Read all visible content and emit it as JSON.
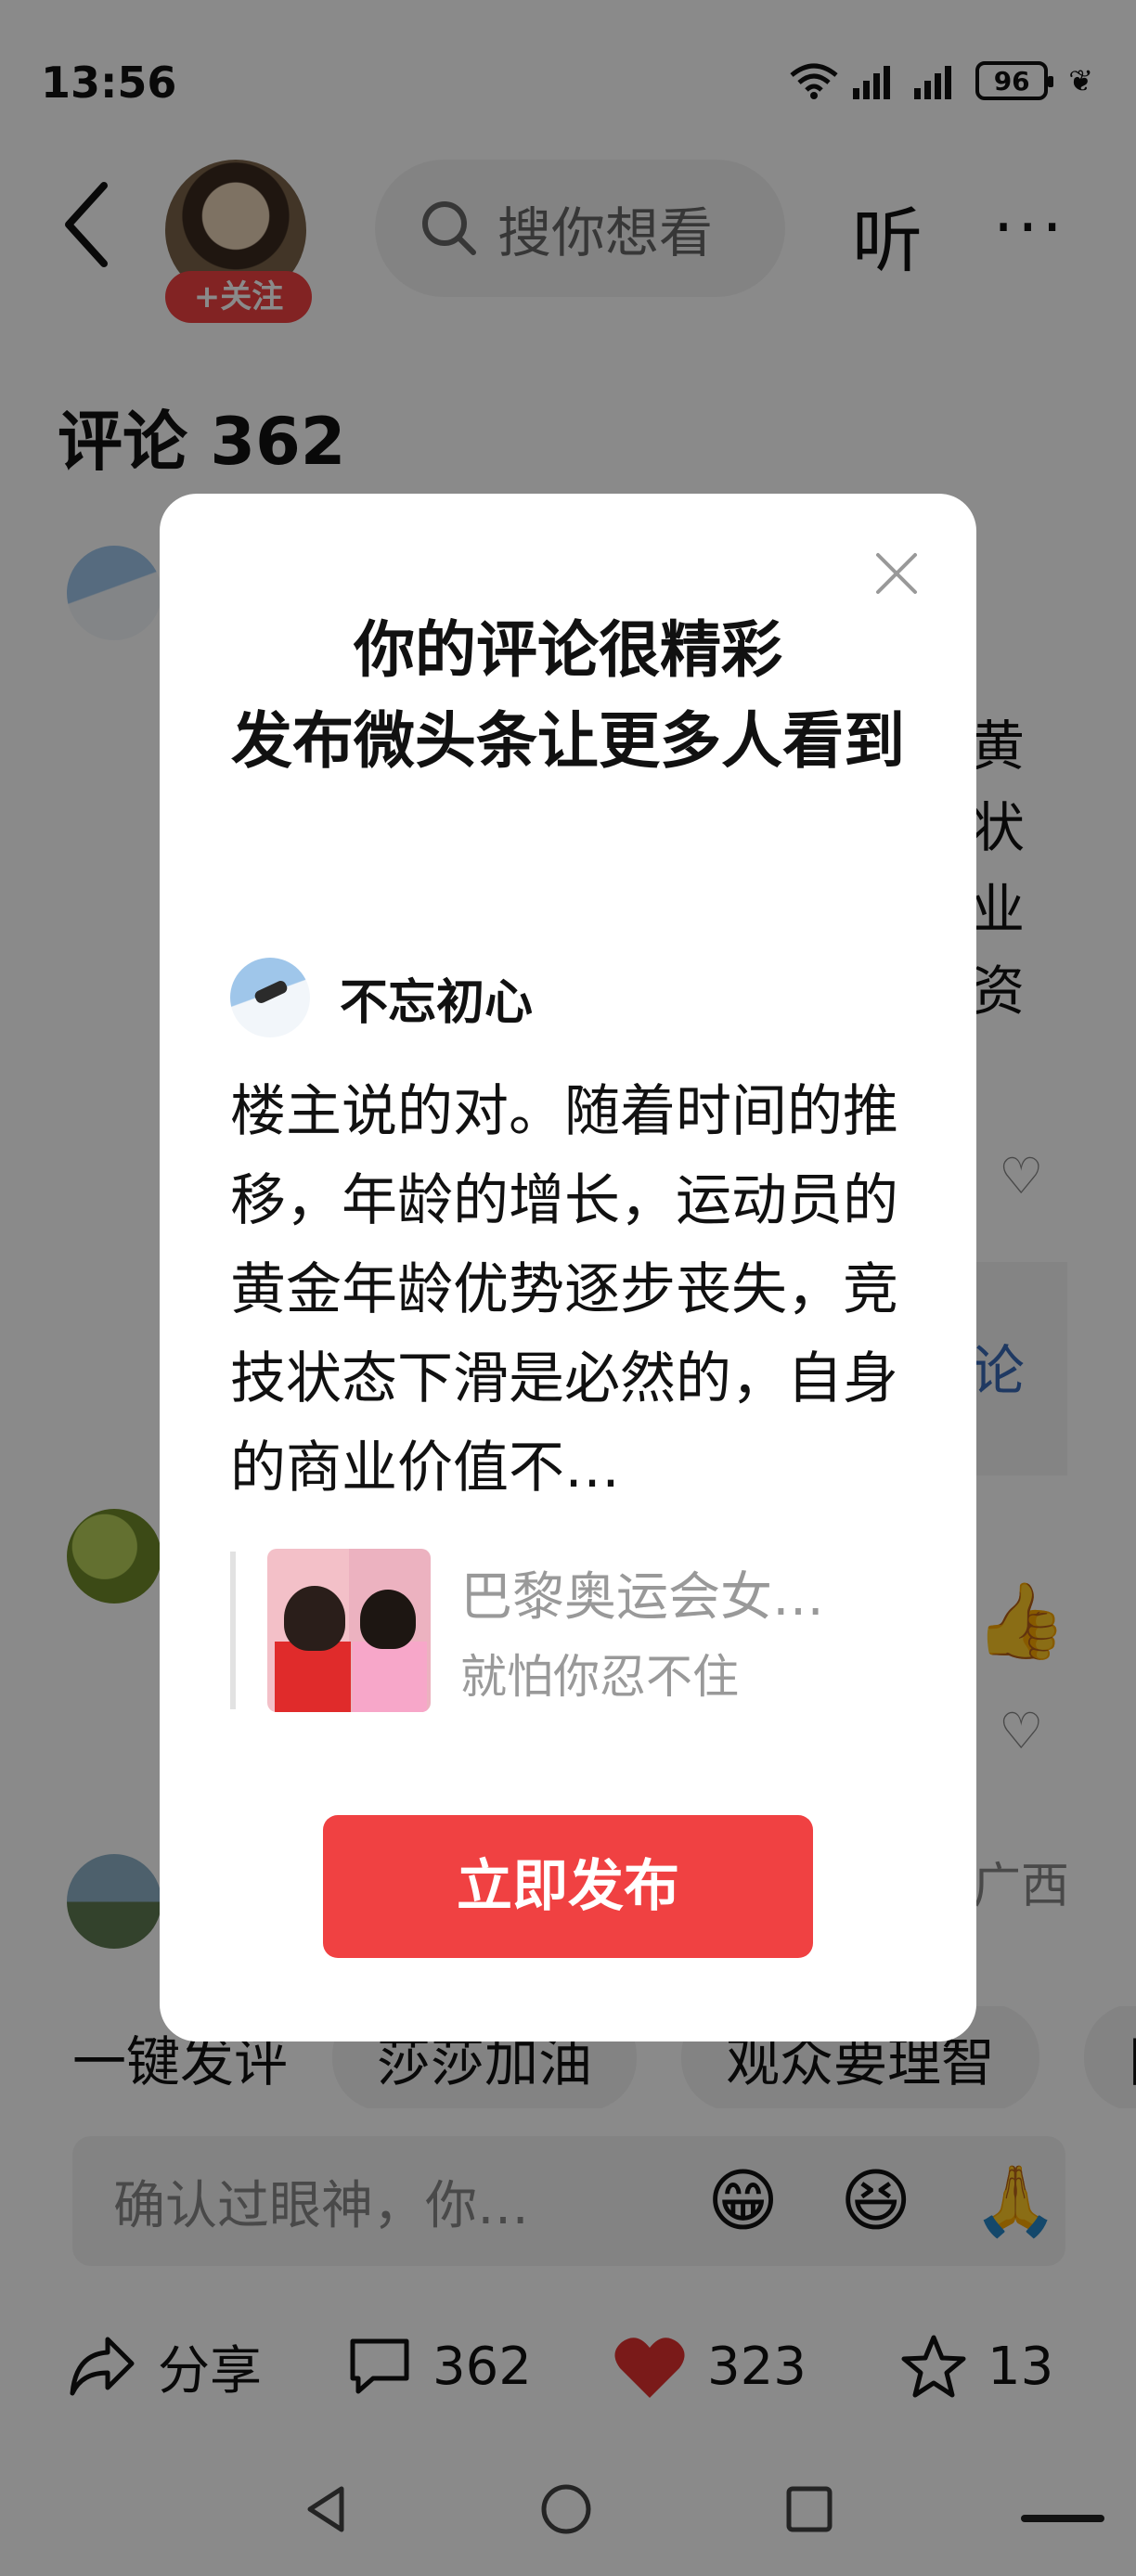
{
  "status_bar": {
    "time": "13:56",
    "battery": "96"
  },
  "header": {
    "follow_label": "+关注",
    "search_placeholder": "搜你想看",
    "listen_label": "听",
    "more_label": "···"
  },
  "comments": {
    "title": "评论 362",
    "peek_text": [
      "黄",
      "状",
      "业",
      "资"
    ],
    "reply_link_peek": "论",
    "location_peek": "广西"
  },
  "quick_comments": [
    "一键发评",
    "莎莎加油",
    "观众要理智",
    "网"
  ],
  "input_bar": {
    "placeholder": "确认过眼神，你…",
    "emojis": [
      "😁",
      "😆",
      "🙏"
    ]
  },
  "action_bar": {
    "share_label": "分享",
    "comment_count": "362",
    "like_count": "323",
    "favorite_count": "13"
  },
  "modal": {
    "title": "你的评论很精彩\n发布微头条让更多人看到",
    "author": "不忘初心",
    "comment": "楼主说的对。随着时间的推移，年龄的增长，运动员的黄金年龄优势逐步丧失，竞技状态下滑是必然的，自身的商业价值不…",
    "quote_title": "巴黎奥运会女…",
    "quote_subtitle": "就怕你忍不住",
    "publish_label": "立即发布"
  },
  "colors": {
    "brand_red": "#f04142",
    "overlay": "rgba(0,0,0,0.46)"
  }
}
